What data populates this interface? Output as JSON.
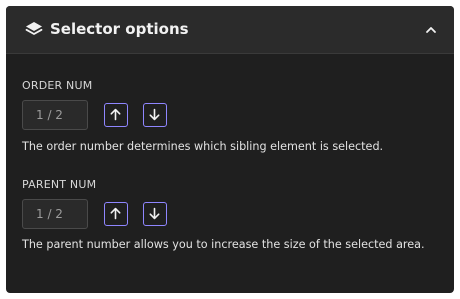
{
  "panel": {
    "title": "Selector options",
    "header_icon": "layers-icon",
    "collapse_icon": "chevron-up-icon"
  },
  "order": {
    "label": "ORDER NUM",
    "value": "1 / 2",
    "up_icon": "arrow-up-icon",
    "down_icon": "arrow-down-icon",
    "description": "The order number determines which sibling element is selected."
  },
  "parent": {
    "label": "PARENT NUM",
    "value": "1 / 2",
    "up_icon": "arrow-up-icon",
    "down_icon": "arrow-down-icon",
    "description": "The parent number allows you to increase the size of the selected area."
  },
  "colors": {
    "panel_bg": "#1f1f1f",
    "header_bg": "#2b2b2b",
    "accent": "#8f86ff",
    "text": "#e2e2e2"
  }
}
